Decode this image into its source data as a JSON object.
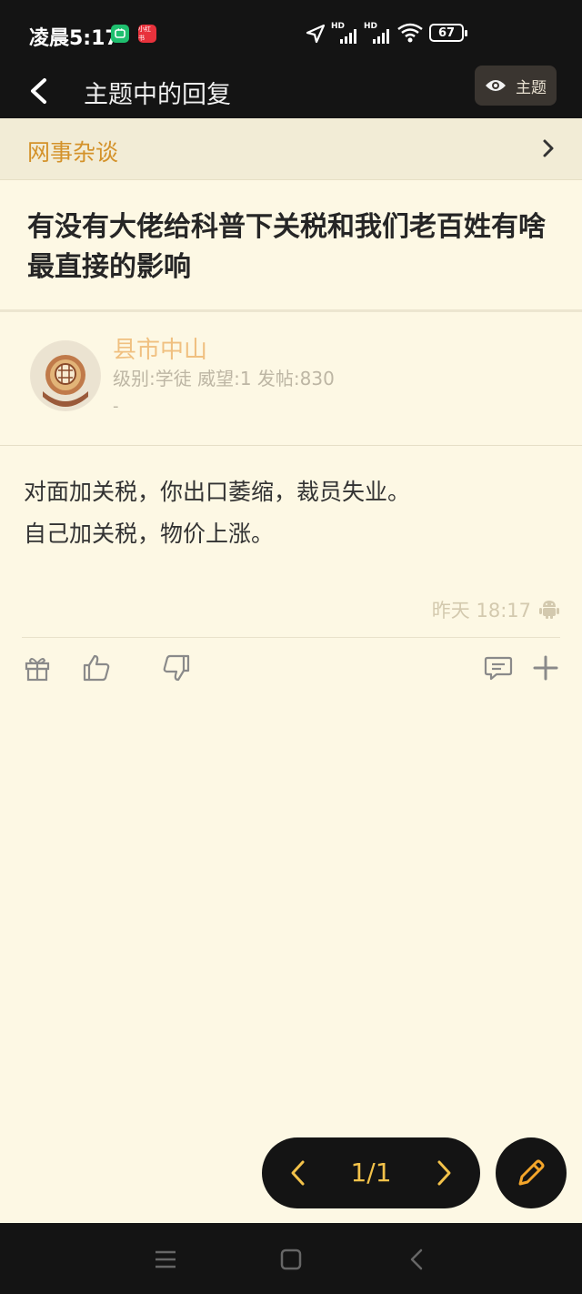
{
  "status": {
    "time": "凌晨5:17",
    "badge_red_text": "小红书",
    "battery": "67",
    "hd1": "HD",
    "hd2": "HD"
  },
  "header": {
    "title": "主题中的回复",
    "topic_button_label": "主题"
  },
  "category": {
    "name": "网事杂谈"
  },
  "topic": {
    "title": "有没有大佬给科普下关税和我们老百姓有啥最直接的影响"
  },
  "author": {
    "name": "县市中山",
    "meta": "级别:学徒 威望:1 发帖:830",
    "extra": "-"
  },
  "post": {
    "lines": [
      "对面加关税，你出口萎缩，裁员失业。",
      "自己加关税，物价上涨。"
    ],
    "time": "昨天 18:17"
  },
  "pager": {
    "text": "1/1"
  },
  "colors": {
    "background": "#fdf8e4",
    "accent": "#d4922a",
    "pager_text": "#f3c24a",
    "dark": "#141414"
  },
  "icons": {
    "back": "chevron-left-icon",
    "eye": "eye-icon",
    "chevron": "chevron-right-icon",
    "gift": "gift-icon",
    "thumb_up": "thumbs-up-icon",
    "thumb_down": "thumbs-down-icon",
    "comment": "comment-icon",
    "plus": "plus-icon",
    "edit": "pencil-icon",
    "android": "android-icon"
  }
}
